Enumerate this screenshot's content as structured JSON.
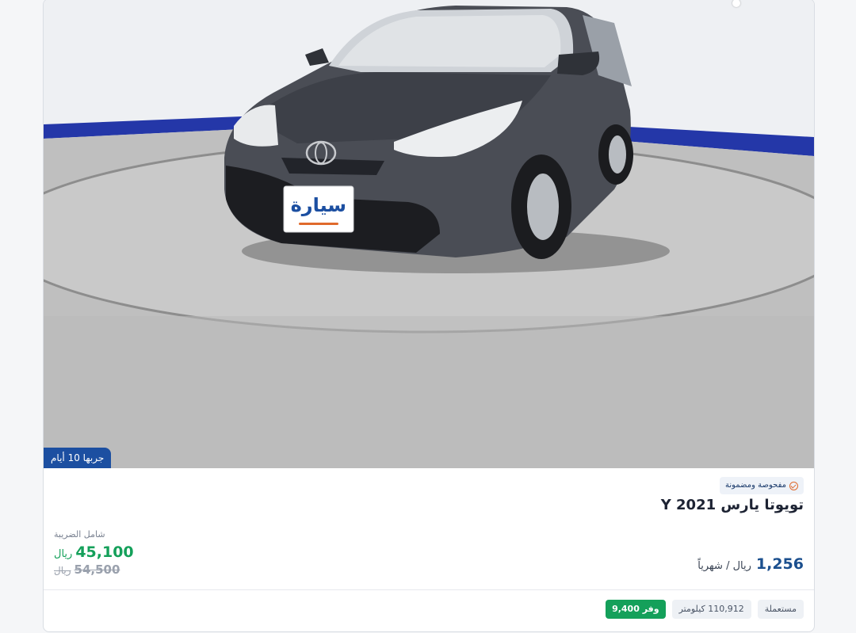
{
  "listing": {
    "trial_badge": "جربها 10 أيام",
    "inspected_label": "مفحوصة ومضمونة",
    "title": "تويوتا يارس 2021 Y",
    "monthly_amount": "1,256",
    "monthly_unit": "ريال / شهرياً",
    "tax_label": "شامل الضريبة",
    "price": "45,100",
    "price_currency": "ريال",
    "old_price": "54,500",
    "old_price_currency": "ريال",
    "tags": {
      "condition": "مستعملة",
      "mileage": "110,912 كيلومتر",
      "save_prefix": "وفر",
      "save_amount": "9,400"
    },
    "plate_brand": "سيارة"
  },
  "colors": {
    "accent_blue": "#1c4fa1",
    "price_green": "#14a05a",
    "monthly_blue": "#1b4f8e",
    "brand_orange": "#e06a2c"
  }
}
